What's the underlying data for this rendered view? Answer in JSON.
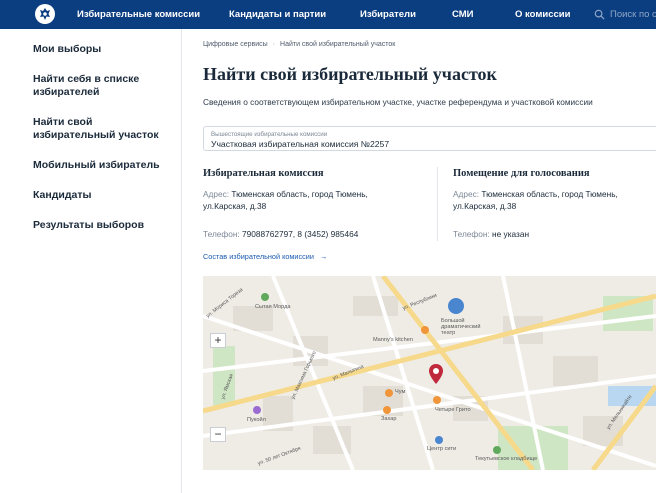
{
  "header": {
    "nav": [
      {
        "label": "Избирательные комиссии"
      },
      {
        "label": "Кандидаты и партии"
      },
      {
        "label": "Избиратели"
      },
      {
        "label": "СМИ"
      },
      {
        "label": "О комиссии"
      }
    ],
    "search_placeholder": "Поиск по сайту",
    "colors": {
      "topbar": "#0b3e80",
      "link": "#1b5bb0"
    }
  },
  "sidebar": {
    "items": [
      {
        "label": "Мои выборы"
      },
      {
        "label": "Найти себя в списке избирателей"
      },
      {
        "label": "Найти свой избирательный участок"
      },
      {
        "label": "Мобильный избиратель"
      },
      {
        "label": "Кандидаты"
      },
      {
        "label": "Результаты выборов"
      }
    ]
  },
  "main": {
    "breadcrumbs": [
      "Цифровые сервисы",
      "Найти свой избирательный участок"
    ],
    "title": "Найти свой избирательный участок",
    "subtitle": "Сведения о соответствующем избирательном участке, участке референдума и участковой комиссии",
    "commission_select": {
      "label": "Вышестоящие избирательные комиссии",
      "value": "Участковая избирательная комиссия №2257"
    },
    "commission": {
      "title": "Избирательная комиссия",
      "address_label": "Адрес:",
      "address_line1": "Тюменская область, город Тюмень,",
      "address_line2": "ул.Карская, д.38",
      "phone_label": "Телефон:",
      "phone": "79088762797, 8 (3452) 985464"
    },
    "voting_room": {
      "title": "Помещение для голосования",
      "address_label": "Адрес:",
      "address_line1": "Тюменская область, город Тюмень,",
      "address_line2": "ул.Карская, д.38",
      "phone_label": "Телефон:",
      "phone": "не указан"
    },
    "composition_link": "Состав избирательной комиссии",
    "composition_arrow": "→"
  },
  "map": {
    "zoom_in": "+",
    "zoom_out": "−",
    "pois": [
      {
        "label": "Сытая Морда"
      },
      {
        "label": "Большой драматический театр"
      },
      {
        "label": "Manny's kitchen"
      },
      {
        "label": "Чум"
      },
      {
        "label": "Захар"
      },
      {
        "label": "Четыре Грито"
      },
      {
        "label": "Центр сити"
      },
      {
        "label": "Текутьевское кладбище"
      },
      {
        "label": "Пукойл"
      }
    ],
    "streets": [
      {
        "label": "ул. Мориса Тореза"
      },
      {
        "label": "ул. Республики"
      },
      {
        "label": "ул. Малыгина"
      },
      {
        "label": "ул. Максима Горького"
      },
      {
        "label": "ул. Ямская"
      },
      {
        "label": "ул. 50 лет Октября"
      },
      {
        "label": "ул. Мельникайте"
      }
    ],
    "colors": {
      "marker": "#c0283b",
      "water": "#b9d7f0",
      "park": "#cfe6c4",
      "road": "#f6d98b"
    }
  }
}
